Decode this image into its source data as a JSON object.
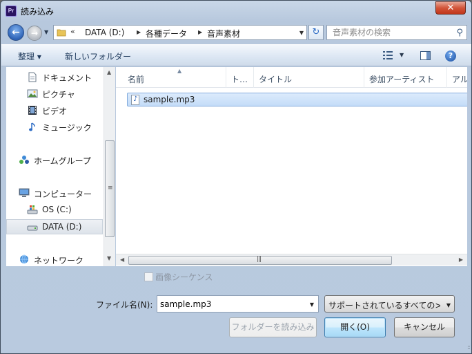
{
  "window": {
    "title": "読み込み",
    "app_icon_text": "Pr",
    "close_label": "✕"
  },
  "address": {
    "overflow": "«",
    "segments": [
      "DATA (D:)",
      "各種データ",
      "音声素材"
    ],
    "search_placeholder": "音声素材の検索"
  },
  "toolbar": {
    "organize_label": "整理 ▾",
    "new_folder_label": "新しいフォルダー",
    "help_label": "?"
  },
  "nav": {
    "items": [
      {
        "label": "ドキュメント",
        "icon": "document-icon"
      },
      {
        "label": "ピクチャ",
        "icon": "picture-icon"
      },
      {
        "label": "ビデオ",
        "icon": "video-icon"
      },
      {
        "label": "ミュージック",
        "icon": "music-icon"
      },
      {
        "label": "ホームグループ",
        "icon": "homegroup-icon"
      },
      {
        "label": "コンピューター",
        "icon": "computer-icon"
      },
      {
        "label": "OS (C:)",
        "icon": "os-drive-icon"
      },
      {
        "label": "DATA (D:)",
        "icon": "drive-icon"
      },
      {
        "label": "ネットワーク",
        "icon": "network-icon"
      }
    ],
    "selected": "DATA (D:)"
  },
  "columns": [
    "名前",
    "ト…",
    "タイトル",
    "参加アーティスト",
    "アル"
  ],
  "files": [
    {
      "name": "sample.mp3",
      "icon": "audio-file-icon"
    }
  ],
  "bottom": {
    "image_sequence_label": "画像シーケンス",
    "filename_label": "ファイル名(N):",
    "filename_value": "sample.mp3",
    "filetype_value": "サポートされているすべての>",
    "import_folder_label": "フォルダーを読み込み",
    "open_label": "開く(O)",
    "cancel_label": "キャンセル"
  },
  "colors": {
    "selection": "#c4dcf8",
    "accent": "#2f64b7",
    "close": "#c0361a"
  }
}
